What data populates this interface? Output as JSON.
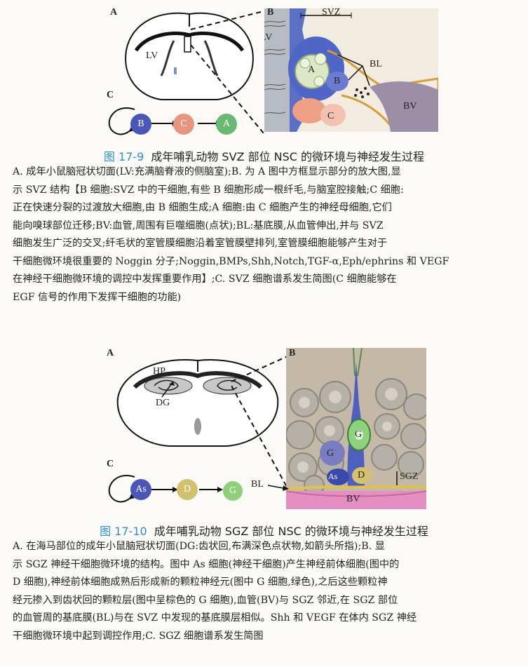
{
  "fig1": {
    "labels": {
      "a": "A",
      "b": "B",
      "c": "C"
    },
    "annot": {
      "lv_brain": "LV",
      "lv_micro": "LV",
      "svz": "SVZ",
      "bl": "BL",
      "bv": "BV",
      "cell_a": "A",
      "cell_b": "B",
      "cell_c": "C"
    },
    "lineage": [
      "B",
      "C",
      "A"
    ],
    "lineage_colors": [
      "#4a57b8",
      "#e8957f",
      "#6ab873"
    ],
    "caption_num": "图 17-9",
    "caption_title": "成年哺乳动物 SVZ 部位 NSC 的微环境与神经发生过程",
    "desc_lines": [
      "A. 成年小鼠脑冠状切面(LV:充满脑脊液的侧脑室);B. 为 A 图中方框显示部分的放大图,显",
      "示 SVZ 结构【B 细胞:SVZ 中的干细胞,有些 B 细胞形成一根纤毛,与脑室腔接触;C 细胞:",
      "正在快速分裂的过渡放大细胞,由 B 细胞生成;A 细胞:由 C 细胞产生的神经母细胞,它们",
      "能向嗅球部位迁移;BV:血管,周围有巨噬细胞(点状);BL:基底膜,从血管伸出,并与 SVZ",
      "细胞发生广泛的交叉;纤毛状的室管膜细胞沿着室管膜壁排列,室管膜细胞能够产生对于",
      "干细胞微环境很重要的 Noggin 分子;Noggin,BMPs,Shh,Notch,TGF-α,Eph/ephrins 和 VEGF",
      "在神经干细胞微环境的调控中发挥重要作用】;C. SVZ 细胞谱系发生简图(C 细胞能够在",
      "EGF 信号的作用下发挥干细胞的功能)"
    ]
  },
  "fig2": {
    "labels": {
      "a": "A",
      "b": "B",
      "c": "C"
    },
    "annot": {
      "hp": "HP",
      "dg": "DG",
      "bl": "BL",
      "sgz": "SGZ",
      "bv": "BV",
      "cell_g1": "G",
      "cell_g2": "G",
      "cell_as": "As",
      "cell_d": "D"
    },
    "lineage": [
      "As",
      "D",
      "G"
    ],
    "lineage_colors": [
      "#4a57b8",
      "#d2c06e",
      "#8fcf7a"
    ],
    "caption_num": "图 17-10",
    "caption_title": "成年哺乳动物 SGZ 部位 NSC 的微环境与神经发生过程",
    "desc_lines": [
      "A. 在海马部位的成年小鼠脑冠状切面(DG:齿状回,布满深色点状物,如箭头所指);B. 显",
      "示 SGZ 神经干细胞微环境的结构。图中 As 细胞(神经干细胞)产生神经前体细胞(图中的",
      "D 细胞),神经前体细胞成熟后形成新的颗粒神经元(图中 G 细胞,绿色),之后这些颗粒神",
      "经元掺入到齿状回的颗粒层(图中呈棕色的 G 细胞),血管(BV)与 SGZ 邻近,在 SGZ 部位",
      "的血管周的基底膜(BL)与在 SVZ 中发现的基底膜层相似。Shh 和 VEGF 在体内 SGZ 神经",
      "干细胞微环境中起到调控作用;C. SGZ 细胞谱系发生简图"
    ]
  }
}
